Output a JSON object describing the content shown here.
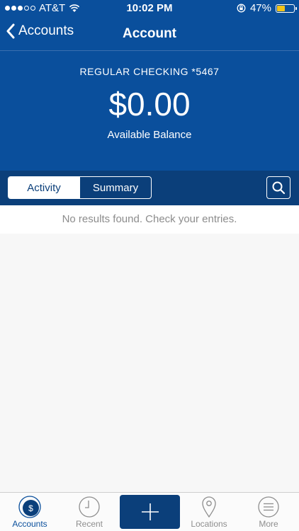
{
  "status_bar": {
    "carrier": "AT&T",
    "time": "10:02 PM",
    "battery": "47%",
    "battery_level": 0.47,
    "battery_color": "#f2c318"
  },
  "nav": {
    "back_label": "Accounts",
    "title": "Account"
  },
  "account": {
    "name": "REGULAR CHECKING *5467",
    "balance": "$0.00",
    "balance_label": "Available Balance"
  },
  "tabs_segment": {
    "activity": "Activity",
    "summary": "Summary"
  },
  "results": {
    "empty_message": "No results found. Check your entries."
  },
  "tabbar": {
    "accounts": "Accounts",
    "recent": "Recent",
    "locations": "Locations",
    "more": "More"
  },
  "colors": {
    "brand": "#0a4f9c",
    "brand_dark": "#0b3f7a"
  }
}
